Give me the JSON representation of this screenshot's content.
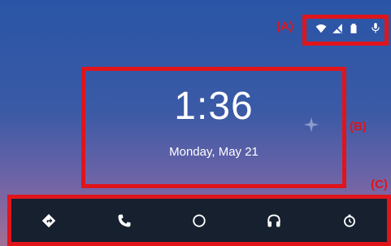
{
  "annotations": {
    "a": "(A)",
    "b": "(B)",
    "c": "(C)"
  },
  "status_bar": {
    "icons": [
      "wifi-icon",
      "no-signal-icon",
      "battery-icon",
      "microphone-icon"
    ]
  },
  "clock": {
    "time": "1:36",
    "date": "Monday, May 21"
  },
  "nav": {
    "items": [
      "navigation-icon",
      "phone-icon",
      "home-icon",
      "headphones-icon",
      "recents-icon"
    ]
  },
  "colors": {
    "highlight": "#e0141b",
    "nav_bg": "#16202e",
    "text": "#ffffff"
  }
}
